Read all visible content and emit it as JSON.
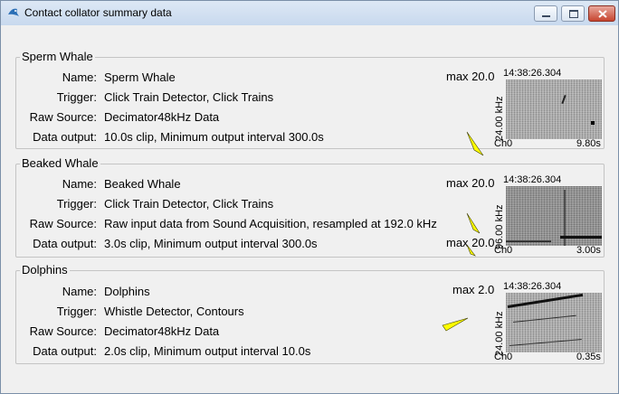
{
  "window": {
    "title": "Contact collator summary data",
    "icons": {
      "app": "whale-app-icon",
      "minimize": "minimize-icon",
      "maximize": "maximize-icon",
      "close": "close-icon"
    }
  },
  "labels": {
    "name": "Name:",
    "trigger": "Trigger:",
    "raw_source": "Raw Source:",
    "data_output": "Data output:"
  },
  "groups": [
    {
      "title": "Sperm Whale",
      "name": "Sperm Whale",
      "trigger": "Click Train Detector, Click Trains",
      "raw_source": "Decimator48kHz Data",
      "data_output": "10.0s clip, Minimum output interval 300.0s",
      "max_label": "max 20.0",
      "time": "14:38:26.304",
      "freq_label": "24.00 kHz",
      "channel": "Ch0",
      "duration": "9.80s"
    },
    {
      "title": "Beaked Whale",
      "name": "Beaked Whale",
      "trigger": "Click Train Detector, Click Trains",
      "raw_source": "Raw input data from Sound Acquisition, resampled at 192.0 kHz",
      "data_output": "3.0s clip, Minimum output interval 300.0s",
      "max_label": "max 20.0",
      "max_label_2": "max 20.0",
      "time": "14:38:26.304",
      "freq_label": "96.00 kHz",
      "channel": "Ch0",
      "duration": "3.00s"
    },
    {
      "title": "Dolphins",
      "name": "Dolphins",
      "trigger": "Whistle Detector, Contours",
      "raw_source": "Decimator48kHz Data",
      "data_output": "2.0s clip, Minimum output interval 10.0s",
      "max_label": "max 2.0",
      "time": "14:38:26.304",
      "freq_label": "24.00 kHz",
      "channel": "Ch0",
      "duration": "0.35s"
    }
  ]
}
